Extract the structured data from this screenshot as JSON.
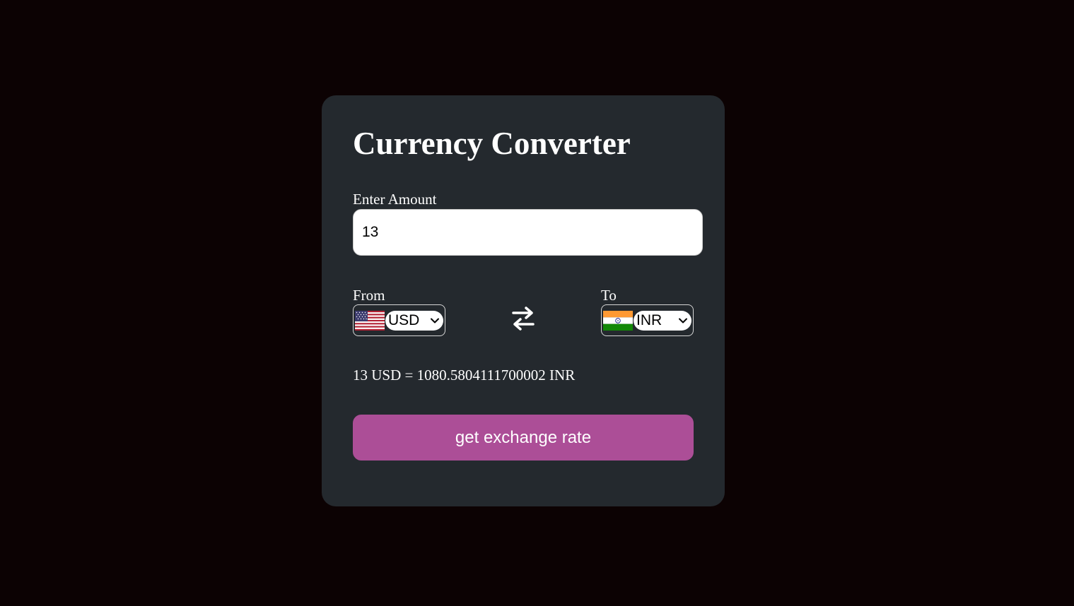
{
  "title": "Currency Converter",
  "amount": {
    "label": "Enter Amount",
    "value": "13"
  },
  "from": {
    "label": "From",
    "currency": "USD",
    "flag_icon": "us-flag-icon"
  },
  "to": {
    "label": "To",
    "currency": "INR",
    "flag_icon": "india-flag-icon"
  },
  "swap_icon": "swap-arrows-icon",
  "result": "13 USD = 1080.5804111700002 INR",
  "button_label": "get exchange rate",
  "colors": {
    "page_background": "#0c0203",
    "card_background": "#24292e",
    "button_background": "#ac4e97",
    "text": "#ffffff"
  }
}
